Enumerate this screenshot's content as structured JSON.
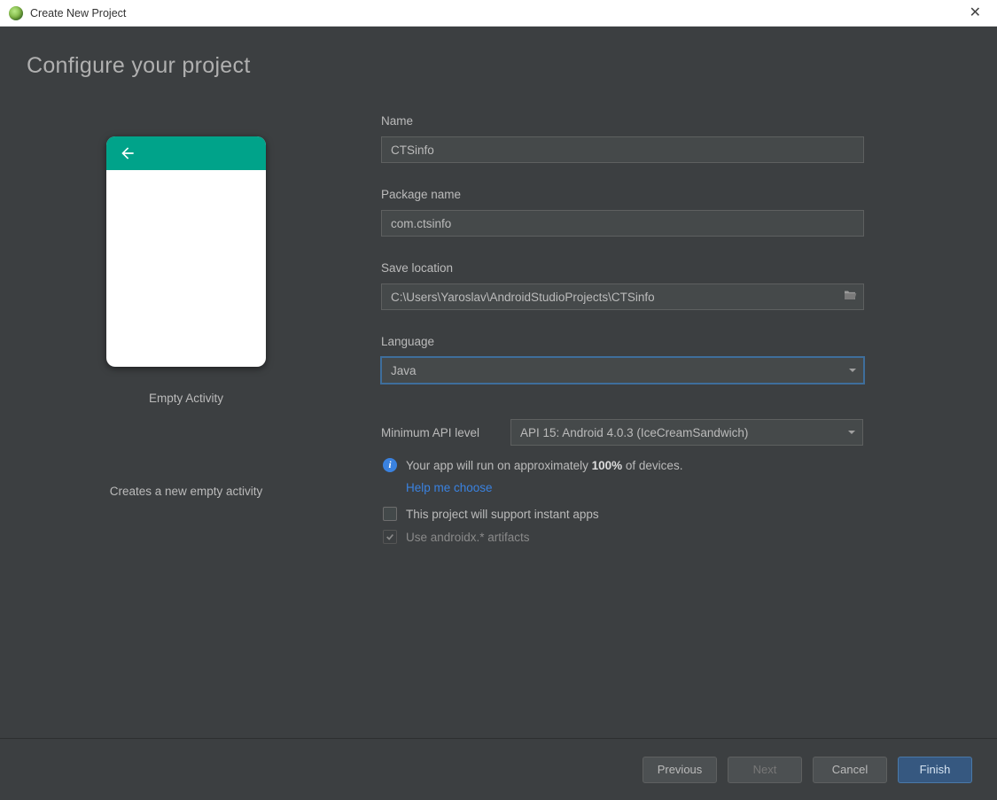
{
  "window": {
    "title": "Create New Project"
  },
  "header": {
    "title": "Configure your project"
  },
  "preview": {
    "label": "Empty Activity",
    "description": "Creates a new empty activity"
  },
  "fields": {
    "name": {
      "label": "Name",
      "value": "CTSinfo"
    },
    "package": {
      "label": "Package name",
      "value": "com.ctsinfo"
    },
    "location": {
      "label": "Save location",
      "value": "C:\\Users\\Yaroslav\\AndroidStudioProjects\\CTSinfo"
    },
    "language": {
      "label": "Language",
      "value": "Java"
    },
    "api": {
      "label": "Minimum API level",
      "value": "API 15: Android 4.0.3 (IceCreamSandwich)"
    }
  },
  "info": {
    "text_prefix": "Your app will run on approximately ",
    "percent": "100%",
    "text_suffix": " of devices.",
    "help_link": "Help me choose"
  },
  "checkboxes": {
    "instant_apps": {
      "label": "This project will support instant apps",
      "checked": false,
      "enabled": true
    },
    "androidx": {
      "label": "Use androidx.* artifacts",
      "checked": true,
      "enabled": false
    }
  },
  "footer": {
    "previous": "Previous",
    "next": "Next",
    "cancel": "Cancel",
    "finish": "Finish"
  }
}
